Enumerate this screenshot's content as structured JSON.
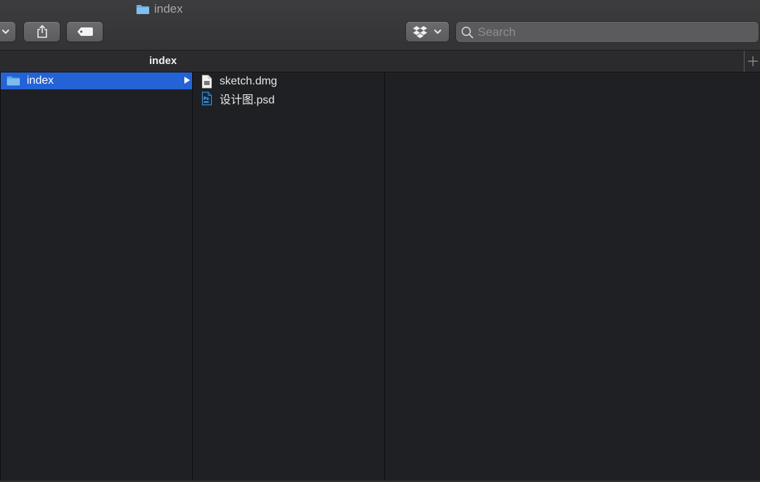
{
  "window": {
    "title": "index"
  },
  "toolbar": {
    "buttons": [
      {
        "name": "view-options",
        "icon": "chevron-down-icon"
      },
      {
        "name": "share",
        "icon": "share-icon"
      },
      {
        "name": "tags",
        "icon": "tag-icon"
      },
      {
        "name": "dropbox",
        "icon": "dropbox-icon"
      }
    ]
  },
  "search": {
    "placeholder": "Search",
    "value": ""
  },
  "tabs": [
    {
      "label": "index",
      "active": true
    }
  ],
  "columns": {
    "first": [
      {
        "name": "index",
        "kind": "folder",
        "selected": true,
        "icon": "folder-icon"
      }
    ],
    "second": [
      {
        "name": "sketch.dmg",
        "kind": "document",
        "icon": "document-icon"
      },
      {
        "name": "设计图.psd",
        "kind": "photoshop",
        "icon": "psd-file-icon",
        "badge": "Ps"
      }
    ]
  },
  "colors": {
    "selection": "#2463d6",
    "folder": "#6db3e8",
    "background": "#1f2023",
    "toolbar": "#3a3a3c"
  }
}
